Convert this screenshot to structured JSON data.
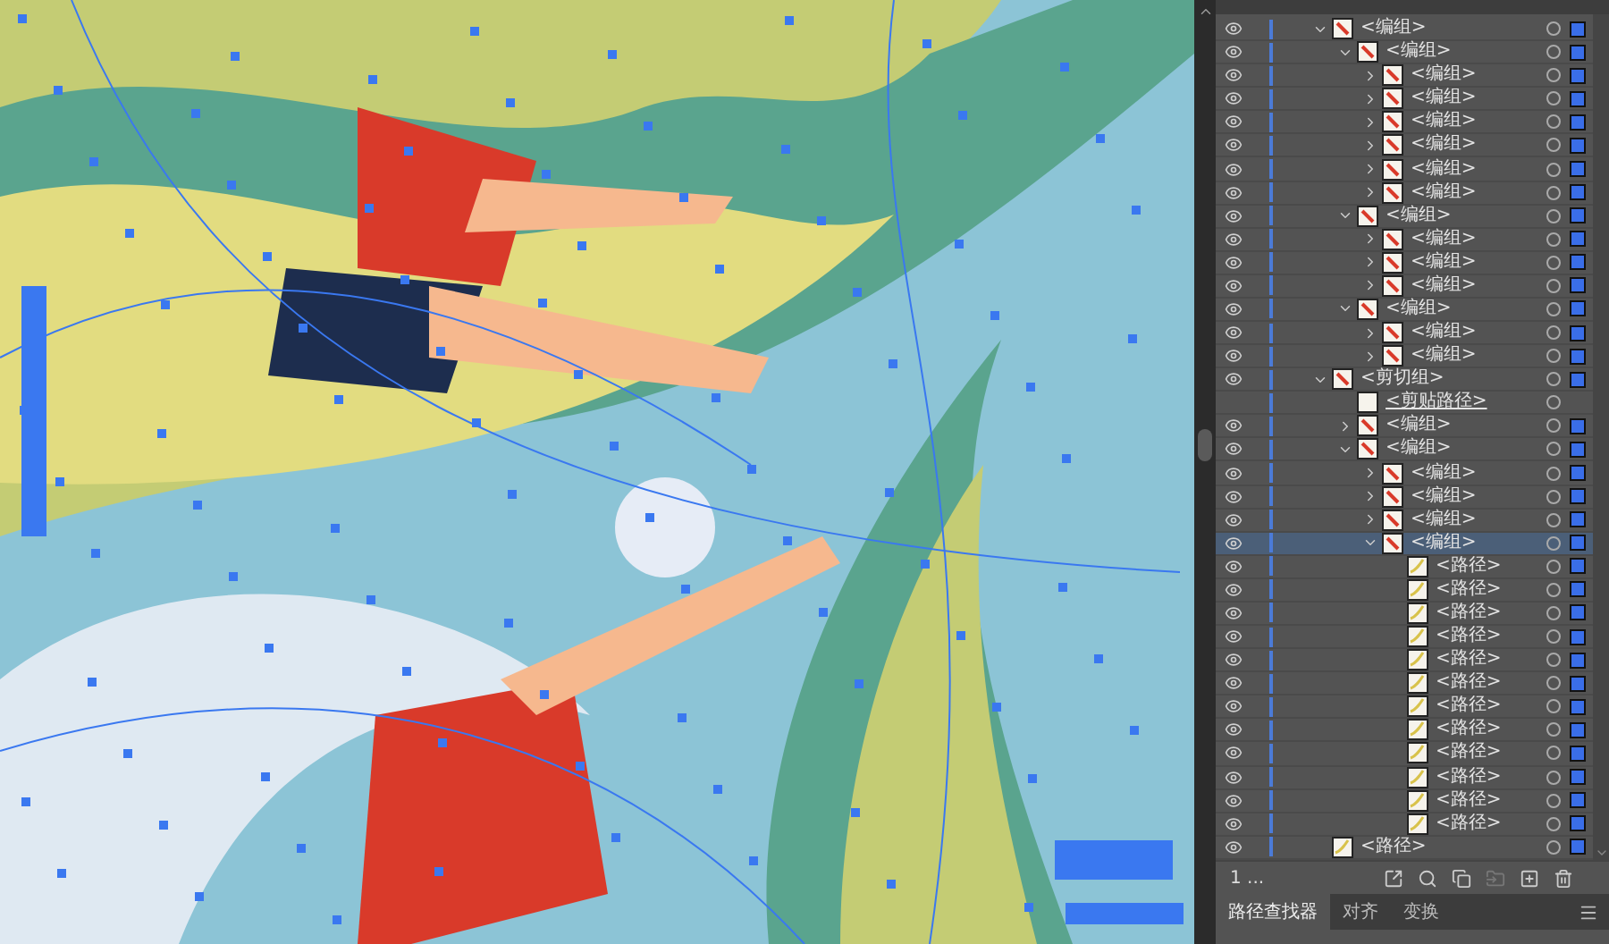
{
  "layers": [
    {
      "kind": "group",
      "name": "<编组>",
      "visible": true,
      "expanded": true,
      "selected": false,
      "children": [
        {
          "kind": "group",
          "name": "<编组>",
          "visible": true,
          "expanded": true,
          "selected": false,
          "children": [
            {
              "kind": "group",
              "name": "<编组>",
              "visible": true,
              "expanded": false,
              "selected": false
            },
            {
              "kind": "group",
              "name": "<编组>",
              "visible": true,
              "expanded": false,
              "selected": false
            },
            {
              "kind": "group",
              "name": "<编组>",
              "visible": true,
              "expanded": false,
              "selected": false
            },
            {
              "kind": "group",
              "name": "<编组>",
              "visible": true,
              "expanded": false,
              "selected": false
            },
            {
              "kind": "group",
              "name": "<编组>",
              "visible": true,
              "expanded": false,
              "selected": false
            },
            {
              "kind": "group",
              "name": "<编组>",
              "visible": true,
              "expanded": false,
              "selected": false
            }
          ]
        },
        {
          "kind": "group",
          "name": "<编组>",
          "visible": true,
          "expanded": true,
          "selected": false,
          "children": [
            {
              "kind": "group",
              "name": "<编组>",
              "visible": true,
              "expanded": false,
              "selected": false
            },
            {
              "kind": "group",
              "name": "<编组>",
              "visible": true,
              "expanded": false,
              "selected": false
            },
            {
              "kind": "group",
              "name": "<编组>",
              "visible": true,
              "expanded": false,
              "selected": false
            }
          ]
        },
        {
          "kind": "group",
          "name": "<编组>",
          "visible": true,
          "expanded": true,
          "selected": false,
          "children": [
            {
              "kind": "group",
              "name": "<编组>",
              "visible": true,
              "expanded": false,
              "selected": false
            },
            {
              "kind": "group",
              "name": "<编组>",
              "visible": true,
              "expanded": false,
              "selected": false
            }
          ]
        }
      ]
    },
    {
      "kind": "group",
      "name": "<剪切组>",
      "visible": true,
      "expanded": true,
      "selected": false,
      "children": [
        {
          "kind": "clip_path",
          "name": "<剪贴路径>",
          "visible": false,
          "selected": false
        },
        {
          "kind": "group",
          "name": "<编组>",
          "visible": true,
          "expanded": false,
          "selected": false
        },
        {
          "kind": "group",
          "name": "<编组>",
          "visible": true,
          "expanded": true,
          "selected": false,
          "children": [
            {
              "kind": "group",
              "name": "<编组>",
              "visible": true,
              "expanded": false,
              "selected": false
            },
            {
              "kind": "group",
              "name": "<编组>",
              "visible": true,
              "expanded": false,
              "selected": false
            },
            {
              "kind": "group",
              "name": "<编组>",
              "visible": true,
              "expanded": false,
              "selected": false
            },
            {
              "kind": "group",
              "name": "<编组>",
              "visible": true,
              "expanded": true,
              "selected": true,
              "children": [
                {
                  "kind": "path",
                  "name": "<路径>",
                  "visible": true,
                  "selected": false
                },
                {
                  "kind": "path",
                  "name": "<路径>",
                  "visible": true,
                  "selected": false
                },
                {
                  "kind": "path",
                  "name": "<路径>",
                  "visible": true,
                  "selected": false
                },
                {
                  "kind": "path",
                  "name": "<路径>",
                  "visible": true,
                  "selected": false
                },
                {
                  "kind": "path",
                  "name": "<路径>",
                  "visible": true,
                  "selected": false
                },
                {
                  "kind": "path",
                  "name": "<路径>",
                  "visible": true,
                  "selected": false
                },
                {
                  "kind": "path",
                  "name": "<路径>",
                  "visible": true,
                  "selected": false
                },
                {
                  "kind": "path",
                  "name": "<路径>",
                  "visible": true,
                  "selected": false
                },
                {
                  "kind": "path",
                  "name": "<路径>",
                  "visible": true,
                  "selected": false
                },
                {
                  "kind": "path",
                  "name": "<路径>",
                  "visible": true,
                  "selected": false
                },
                {
                  "kind": "path",
                  "name": "<路径>",
                  "visible": true,
                  "selected": false
                },
                {
                  "kind": "path",
                  "name": "<路径>",
                  "visible": true,
                  "selected": false
                }
              ]
            }
          ]
        }
      ]
    },
    {
      "kind": "path",
      "name": "<路径>",
      "visible": true,
      "selected": false
    }
  ],
  "layers_footer": {
    "count": "1 ..."
  },
  "bottom_tabs": [
    {
      "label": "路径查找器",
      "selected": true
    },
    {
      "label": "对齐",
      "selected": false
    },
    {
      "label": "变换",
      "selected": false
    }
  ]
}
